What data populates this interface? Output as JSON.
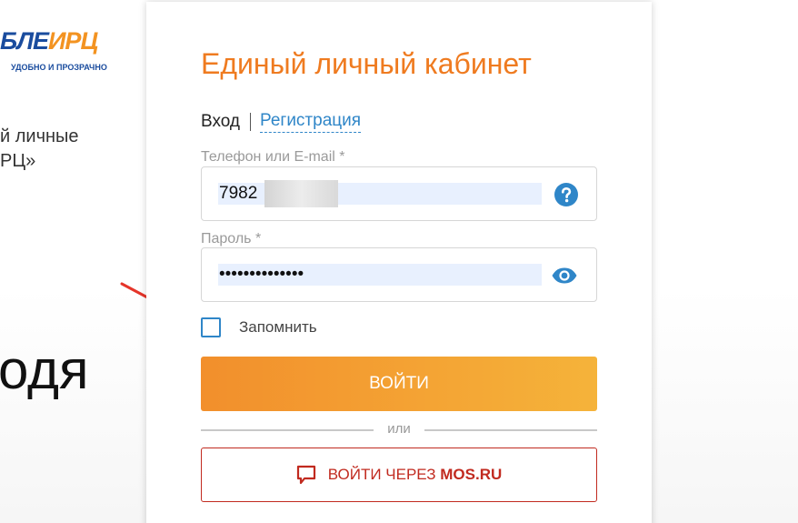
{
  "background": {
    "logo_main": "БЛЕ",
    "logo_accent": "ИРЦ",
    "logo_tagline": "УДОБНО И ПРОЗРАЧНО",
    "caption_line1": "й личные",
    "caption_line2": "РЦ»",
    "big_text": "одя"
  },
  "form": {
    "title": "Единый личный кабинет",
    "tabs": {
      "login": "Вход",
      "register": "Регистрация"
    },
    "phone": {
      "label": "Телефон или E-mail *",
      "value": "7982"
    },
    "password": {
      "label": "Пароль *",
      "value": "••••••••••••••"
    },
    "remember_label": "Запомнить",
    "login_button": "ВОЙТИ",
    "or_label": "или",
    "mos_button_prefix": "ВОЙТИ ЧЕРЕЗ ",
    "mos_button_brand": "MOS.RU"
  },
  "colors": {
    "accent_orange": "#ef7b20",
    "link_blue": "#2f86c8",
    "mos_red": "#c12a1f",
    "arrow_red": "#e5352a"
  },
  "icons": {
    "phone_help": "question-circle-icon",
    "password_toggle": "eye-icon",
    "mos_logo": "chat-bubble-icon",
    "annotation": "arrow-icon"
  }
}
